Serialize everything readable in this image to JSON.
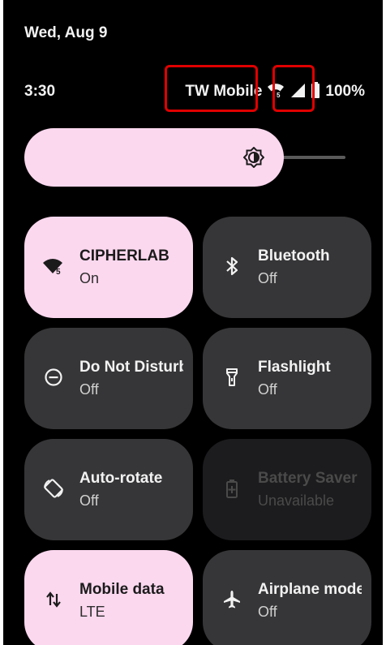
{
  "status_bar": {
    "date": "Wed, Aug 9",
    "time": "3:30",
    "carrier": "TW Mobile",
    "battery_percent": "100%"
  },
  "brightness": {
    "level": 0.7
  },
  "tiles": [
    {
      "title": "CIPHERLAB",
      "state": "On",
      "icon": "wifi-icon",
      "active": true
    },
    {
      "title": "Bluetooth",
      "state": "Off",
      "icon": "bluetooth-icon",
      "active": false
    },
    {
      "title": "Do Not Disturb",
      "state": "Off",
      "icon": "do-not-disturb-icon",
      "active": false
    },
    {
      "title": "Flashlight",
      "state": "Off",
      "icon": "flashlight-icon",
      "active": false
    },
    {
      "title": "Auto-rotate",
      "state": "Off",
      "icon": "auto-rotate-icon",
      "active": false
    },
    {
      "title": "Battery Saver",
      "state": "Unavailable",
      "icon": "battery-saver-icon",
      "active": false
    },
    {
      "title": "Mobile data",
      "state": "LTE",
      "icon": "mobile-data-icon",
      "active": true
    },
    {
      "title": "Airplane mode",
      "state": "Off",
      "icon": "airplane-icon",
      "active": false
    }
  ],
  "colors": {
    "active_tile": "#fcd8ef",
    "inactive_tile": "#363638",
    "highlight": "#e00000"
  }
}
